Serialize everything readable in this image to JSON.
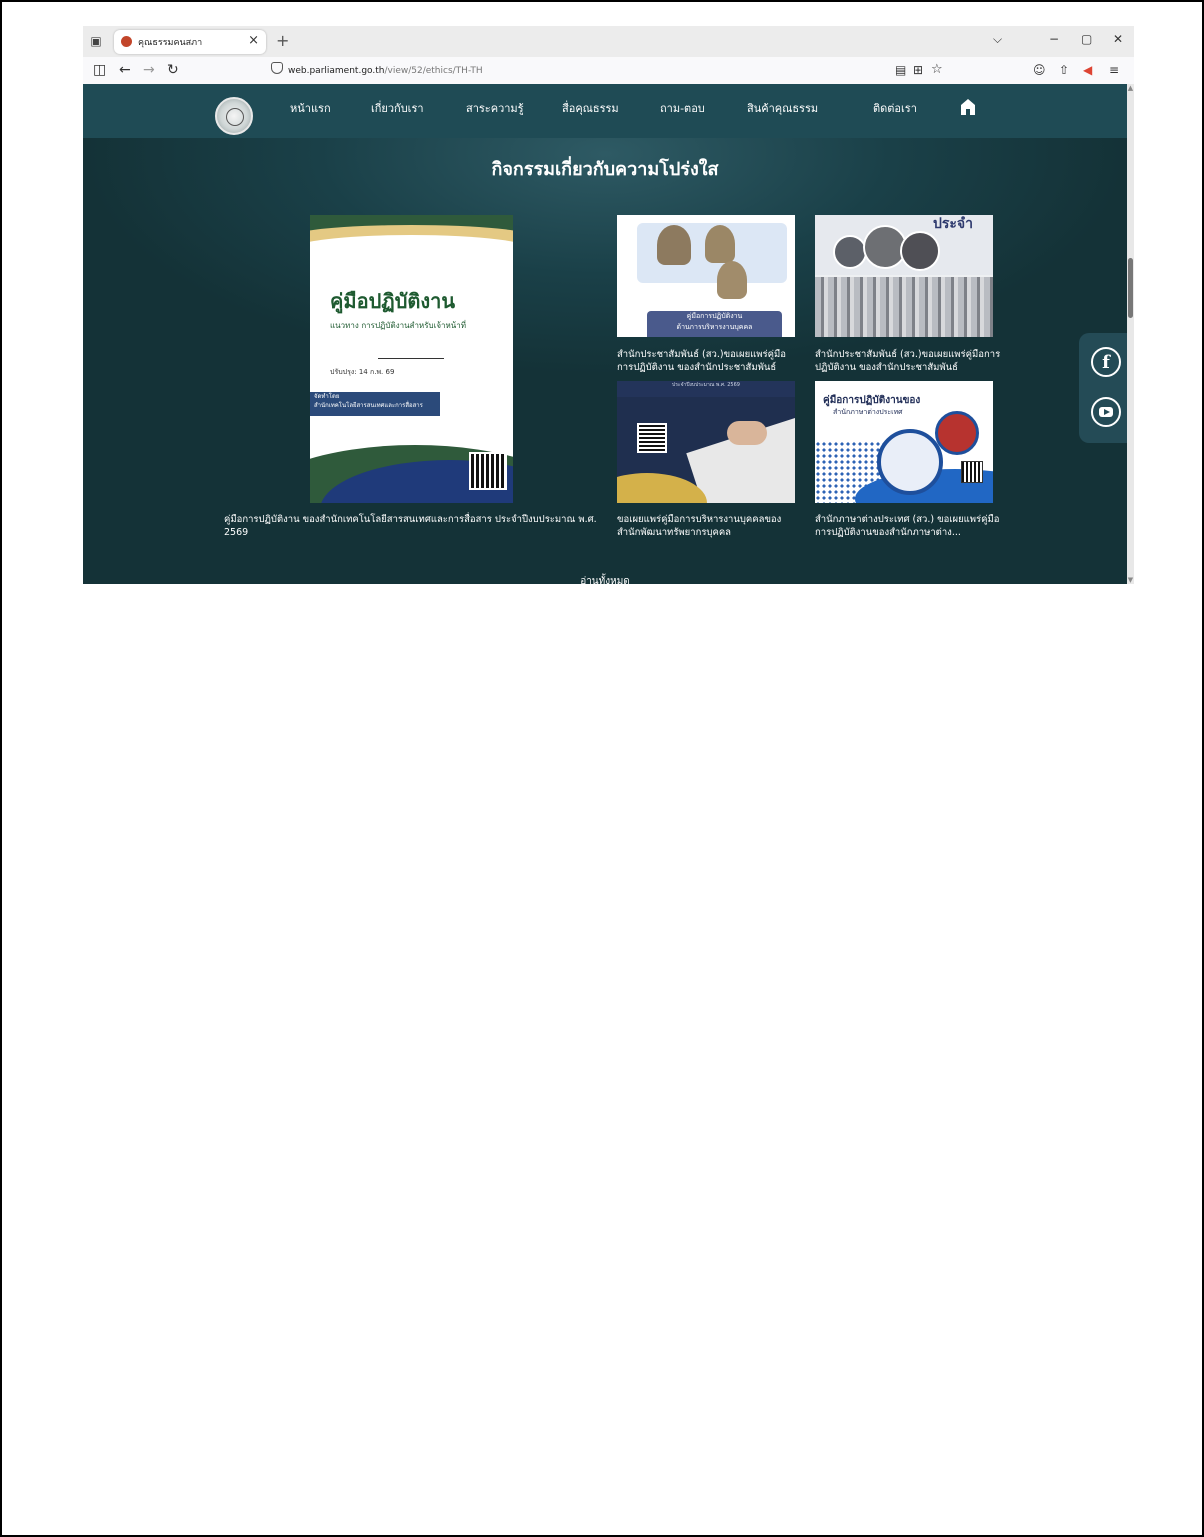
{
  "browser": {
    "tab_title": "คุณธรรมคนสภา",
    "new_tab": "+",
    "tab_close": "×",
    "window_controls": {
      "dropdown": "⌵",
      "minimize": "−",
      "restore": "▢",
      "close": "✕"
    },
    "url_domain": "web.parliament.go.th",
    "url_path": "/view/52/ethics/TH-TH"
  },
  "nav": {
    "items": [
      "หน้าแรก",
      "เกี่ยวกับเรา",
      "สาระความรู้",
      "สื่อคุณธรรม",
      "ถาม-ตอบ",
      "สินค้าคุณธรรม",
      "ติดต่อเรา"
    ]
  },
  "section": {
    "title": "กิจกรรมเกี่ยวกับความโปร่งใส",
    "read_all": "อ่านทั้งหมด"
  },
  "cards": {
    "featured": {
      "thumb_title": "คู่มือปฏิบัติงาน",
      "thumb_subtitle": "แนวทาง การปฏิบัติงานสำหรับเจ้าหน้าที่",
      "thumb_date": "ปรับปรุง: 14 ก.พ. 69",
      "thumb_org_label": "จัดทำโดย",
      "thumb_org": "สำนักเทคโนโลยีสารสนเทศและการสื่อสาร",
      "caption": "คู่มือการปฏิบัติงาน ของสำนักเทคโนโลยีสารสนเทศและการสื่อสาร ประจำปีงบประมาณ พ.ศ. 2569"
    },
    "items": [
      {
        "thumb_label_1": "คู่มือการปฏิบัติงาน",
        "thumb_label_2": "ด้านการบริหารงานบุคคล",
        "caption": "สำนักประชาสัมพันธ์ (สว.)ขอเผยแพร่คู่มือการปฏิบัติงาน ของสำนักประชาสัมพันธ์"
      },
      {
        "thumb_heading": "ประจำ",
        "caption": "สำนักประชาสัมพันธ์ (สว.)ขอเผยแพร่คู่มือการปฏิบัติงาน ของสำนักประชาสัมพันธ์"
      },
      {
        "thumb_header": "ประจำปีงบประมาณ พ.ศ. 2569",
        "caption": "ขอเผยแพร่คู่มือการบริหารงานบุคคลของสำนักพัฒนาทรัพยากรบุคคล"
      },
      {
        "thumb_title": "คู่มือการปฏิบัติงานของ",
        "thumb_subtitle": "สำนักภาษาต่างประเทศ",
        "caption": "สำนักภาษาต่างประเทศ (สว.) ขอเผยแพร่คู่มือการปฏิบัติงานของสำนักภาษาต่าง..."
      }
    ]
  },
  "social": {
    "facebook": "f"
  }
}
